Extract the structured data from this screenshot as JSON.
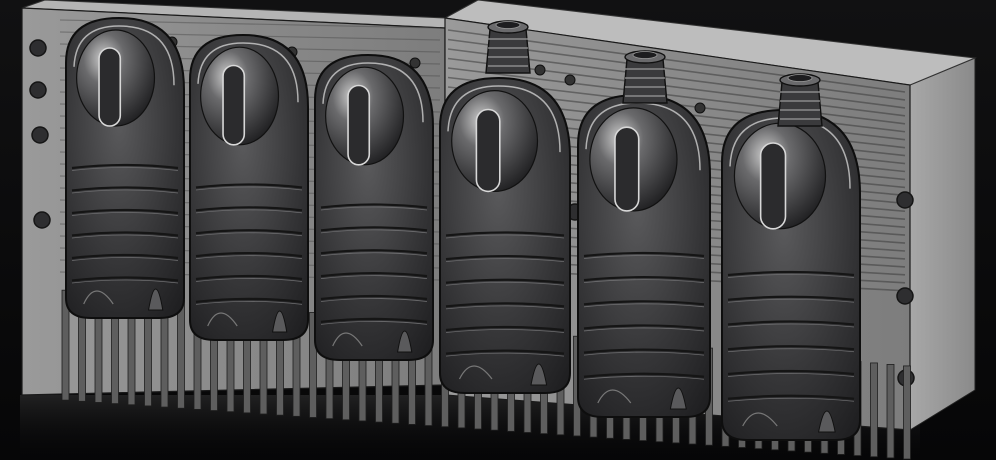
{
  "scene": {
    "subject": "blow-mold-render",
    "colors": {
      "background": "#0b0b0c",
      "mold_face": "#8e8e8e",
      "mold_face_light": "#a9a9a9",
      "mold_side": "#9a9a9a",
      "mold_top": "#b9b9b9",
      "cavity_dark": "#2a2a2c",
      "cavity_mid": "#4a4a4c",
      "edge_line": "#1a1a1a",
      "highlight": "#d8d8d8",
      "reflection": "#3a3a3a"
    },
    "cavity_count": 6,
    "neck_count": 3
  }
}
